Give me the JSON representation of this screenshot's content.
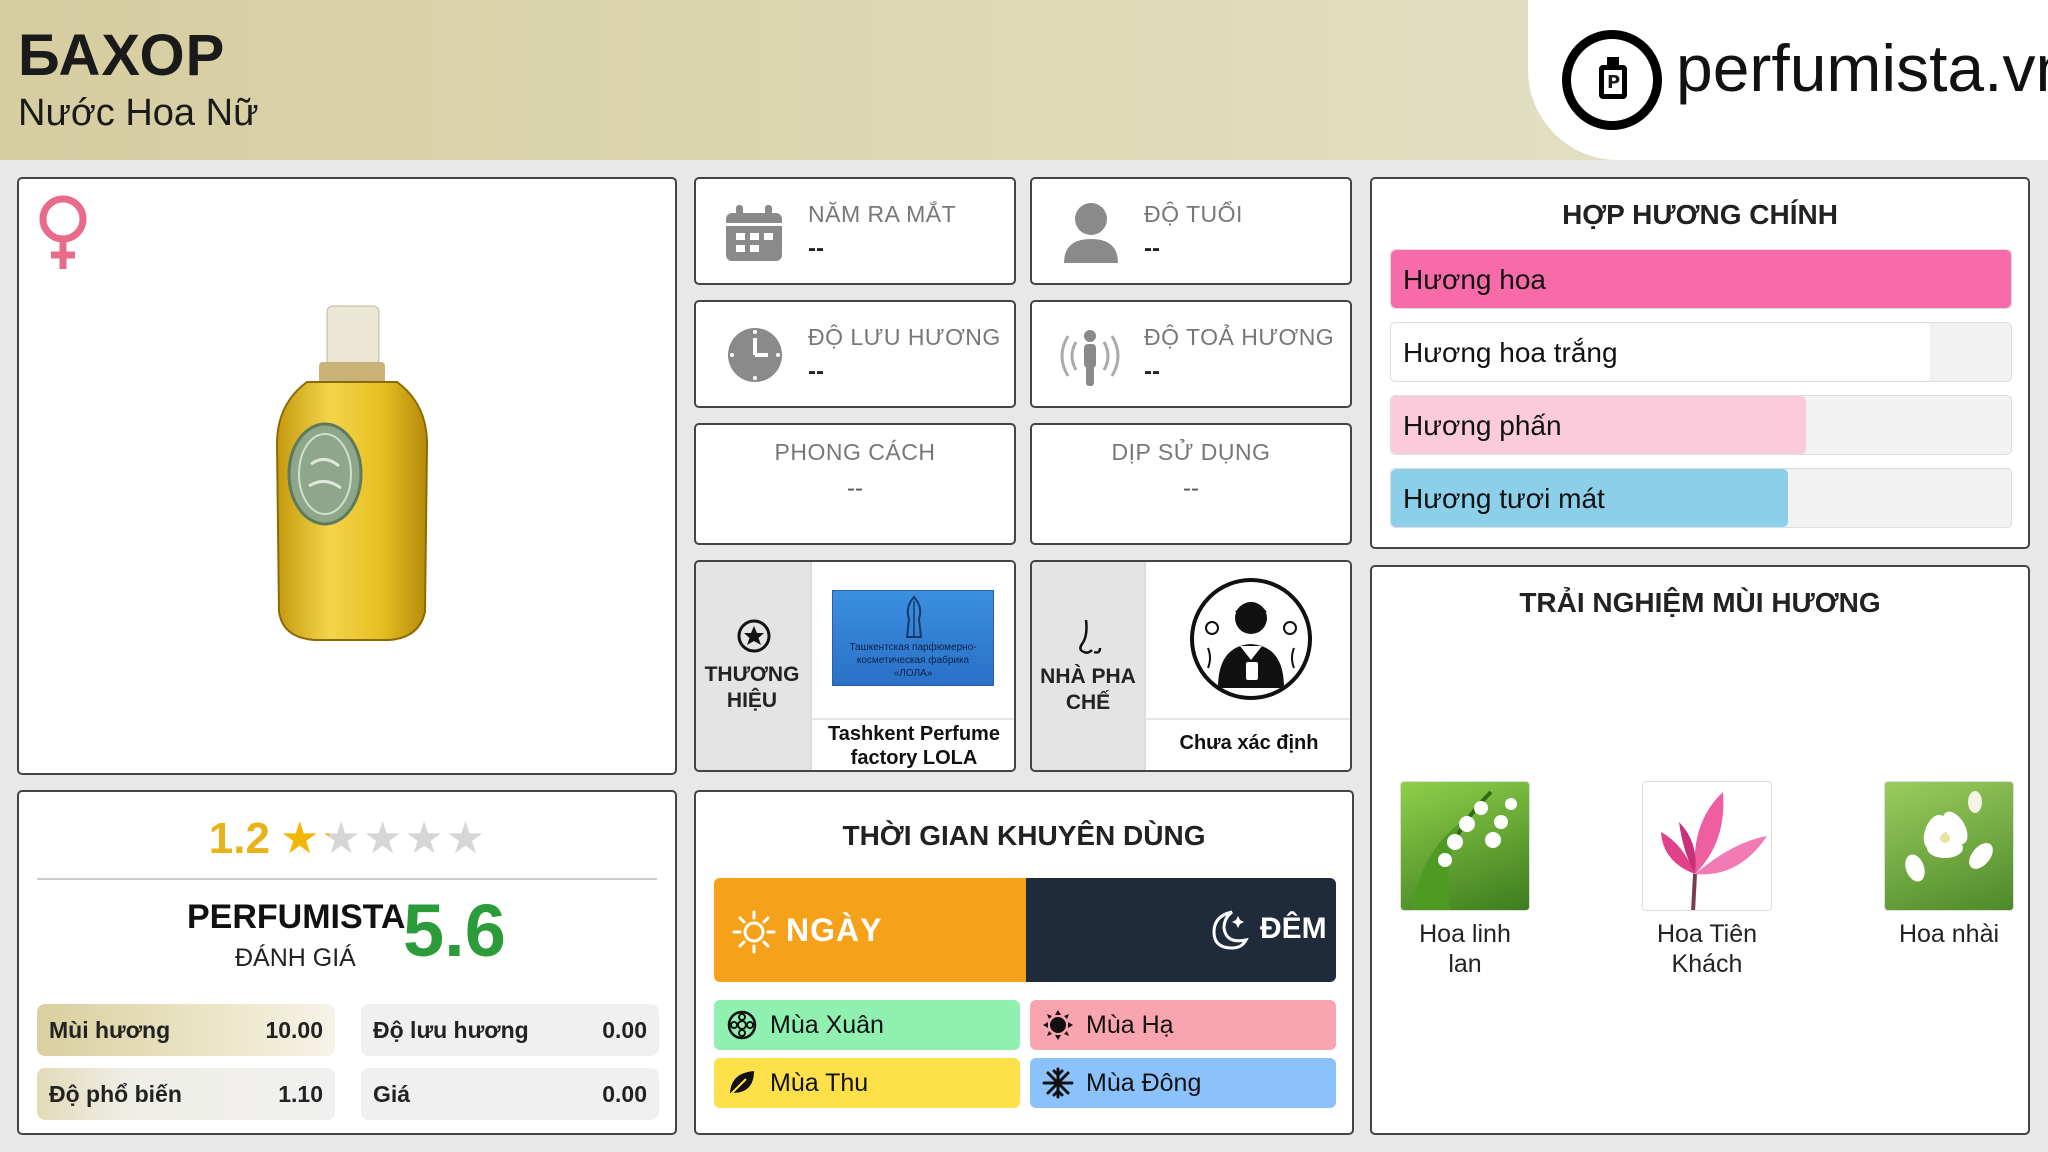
{
  "header": {
    "title": "БАХОР",
    "subtitle": "Nước Hoa Nữ",
    "brand_logo": "perfumista.vn"
  },
  "info": {
    "launch_year": {
      "label": "NĂM RA MẮT",
      "value": "--",
      "icon": "calendar-icon"
    },
    "age": {
      "label": "ĐỘ TUỔI",
      "value": "--",
      "icon": "person-icon"
    },
    "longevity": {
      "label": "ĐỘ LƯU HƯƠNG",
      "value": "--",
      "icon": "clock-icon"
    },
    "sillage": {
      "label": "ĐỘ TOẢ HƯƠNG",
      "value": "--",
      "icon": "radiate-person-icon"
    },
    "style": {
      "label": "PHONG CÁCH",
      "value": "--"
    },
    "occasion": {
      "label": "DỊP SỬ DỤNG",
      "value": "--"
    }
  },
  "brand": {
    "label": "THƯƠNG HIỆU",
    "name": "Tashkent Perfume factory LOLA",
    "logo_text": "Ташкентская парфюмерно-косметическая фабрика «ЛОЛА»"
  },
  "perfumer": {
    "label": "NHÀ PHA CHẾ",
    "name": "Chưa xác định"
  },
  "rating": {
    "user_score": "1.2",
    "user_stars": 1.2,
    "max_stars": 5,
    "perfumista_label": "PERFUMISTA",
    "perfumista_sub": "ĐÁNH GIÁ",
    "perfumista_score": "5.6",
    "metrics": [
      {
        "key": "Mùi hương",
        "value": "10.00"
      },
      {
        "key": "Độ lưu hương",
        "value": "0.00"
      },
      {
        "key": "Độ phổ biến",
        "value": "1.10"
      },
      {
        "key": "Giá",
        "value": "0.00"
      }
    ]
  },
  "accords": {
    "title": "HỢP HƯƠNG CHÍNH",
    "items": [
      {
        "name": "Hương hoa",
        "level": 1.0,
        "color": "#f76ba8"
      },
      {
        "name": "Hương hoa trắng",
        "level": 0.87,
        "color": "#ffffff"
      },
      {
        "name": "Hương phấn",
        "level": 0.67,
        "color": "#fbcbdb"
      },
      {
        "name": "Hương tươi mát",
        "level": 0.64,
        "color": "#8ccfe8"
      }
    ]
  },
  "usage": {
    "title": "THỜI GIAN KHUYÊN DÙNG",
    "day": "NGÀY",
    "night": "ĐÊM",
    "day_color": "#f5a21a",
    "night_color": "#1f2a3a",
    "seasons": [
      {
        "name": "Mùa Xuân",
        "color": "#8ff0b0",
        "icon": "flower-icon"
      },
      {
        "name": "Mùa Hạ",
        "color": "#f9a5b0",
        "icon": "sun-icon"
      },
      {
        "name": "Mùa Thu",
        "color": "#fde04a",
        "icon": "leaf-icon"
      },
      {
        "name": "Mùa Đông",
        "color": "#8cc2fb",
        "icon": "snowflake-icon"
      }
    ]
  },
  "notes": {
    "title": "TRẢI NGHIỆM MÙI HƯƠNG",
    "items": [
      {
        "name": "Hoa linh lan"
      },
      {
        "name": "Hoa Tiên Khách"
      },
      {
        "name": "Hoa nhài"
      }
    ]
  }
}
